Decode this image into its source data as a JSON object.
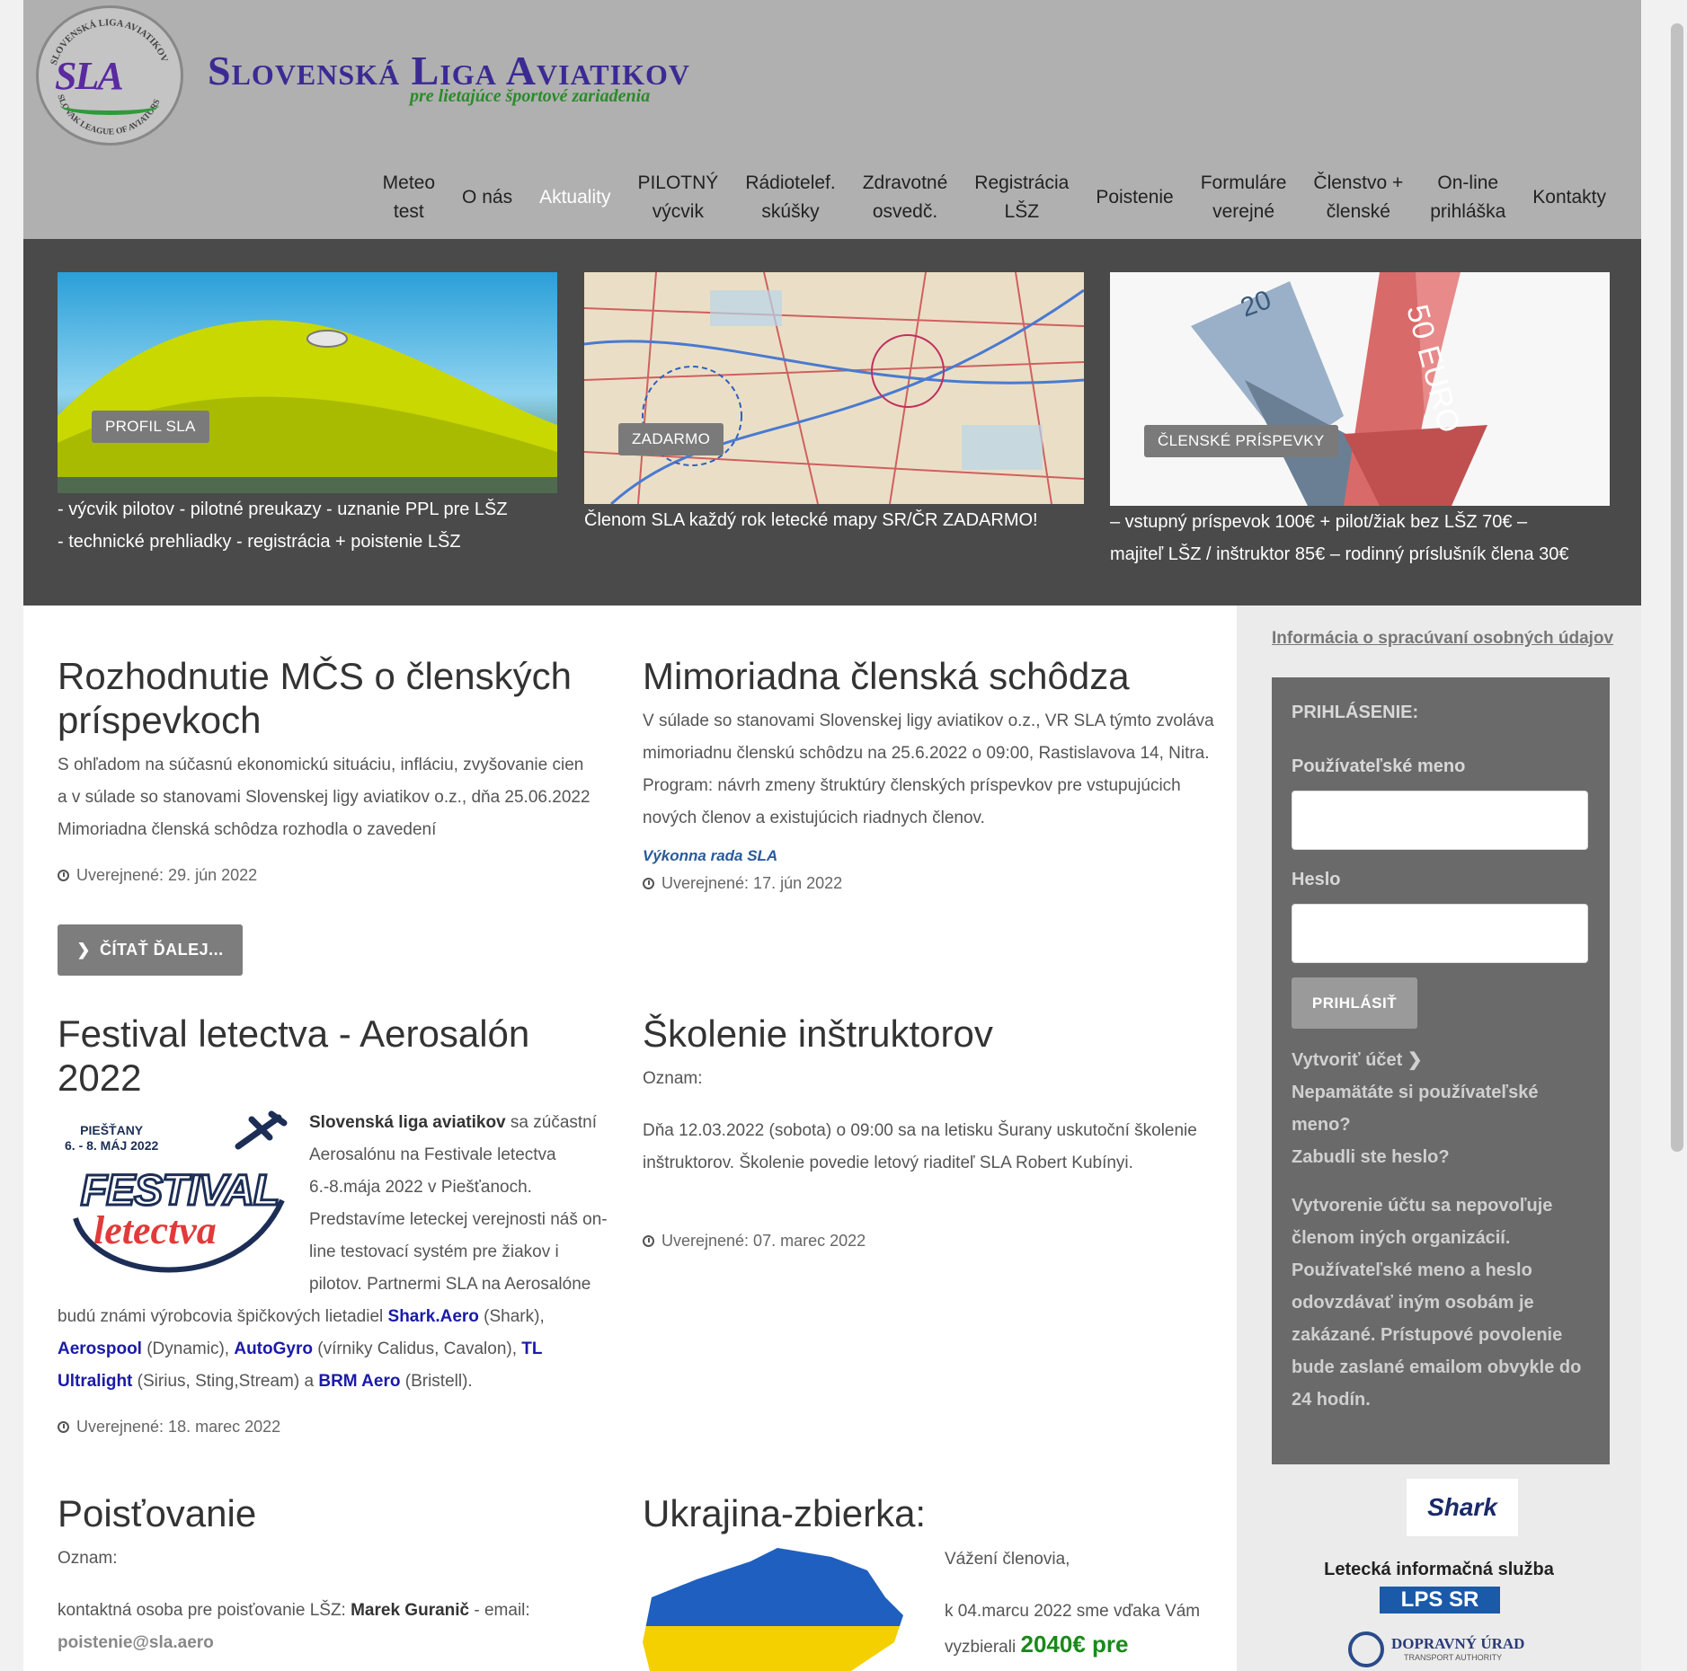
{
  "header": {
    "title": "Slovenská Liga Aviatikov",
    "subtitle": "pre lietajúce športové zariadenia",
    "logo_text": "SLA",
    "logo_ring_top": "SLOVENSKÁ LIGA AVIATIKOV",
    "logo_ring_bottom": "SLOVAK LEAGUE OF AVIATORS"
  },
  "nav": [
    {
      "l1": "Meteo",
      "l2": "test"
    },
    {
      "l1": "O nás",
      "l2": ""
    },
    {
      "l1": "Aktuality",
      "l2": ""
    },
    {
      "l1": "PILOTNÝ",
      "l2": "výcvik"
    },
    {
      "l1": "Rádiotelef.",
      "l2": "skúšky"
    },
    {
      "l1": "Zdravotné",
      "l2": "osvedč."
    },
    {
      "l1": "Registrácia",
      "l2": "LŠZ"
    },
    {
      "l1": "Poistenie",
      "l2": ""
    },
    {
      "l1": "Formuláre",
      "l2": "verejné"
    },
    {
      "l1": "Členstvo +",
      "l2": "členské"
    },
    {
      "l1": "On-line",
      "l2": "prihláška"
    },
    {
      "l1": "Kontakty",
      "l2": ""
    }
  ],
  "featured": [
    {
      "tag": "PROFIL SLA",
      "line1": "- výcvik pilotov - pilotné preukazy - uznanie PPL pre LŠZ",
      "line2": "- technické prehliadky - registrácia + poistenie LŠZ"
    },
    {
      "tag": "ZADARMO",
      "line1": "Členom SLA každý rok letecké mapy SR/ČR ZADARMO!",
      "line2": ""
    },
    {
      "tag": "ČLENSKÉ PRÍSPEVKY",
      "line1": "– vstupný príspevok 100€ + pilot/žiak bez LŠZ 70€ –",
      "line2": "majiteľ LŠZ / inštruktor 85€ – rodinný príslušník člena 30€"
    }
  ],
  "articles": {
    "a1": {
      "title": "Rozhodnutie MČS o členských príspevkoch",
      "body": "S ohľadom na súčasnú ekonomickú situáciu, infláciu, zvyšovanie cien a v súlade so stanovami Slovenskej ligy aviatikov o.z., dňa 25.06.2022 Mimoriadna členská schôdza rozhodla o zavedení",
      "date": "Uverejnené: 29. jún 2022",
      "button": "ČÍTAŤ ĎALEJ..."
    },
    "a2": {
      "title": "Mimoriadna členská schôdza",
      "body": "V súlade so stanovami Slovenskej ligy aviatikov o.z., VR SLA týmto zvoláva mimoriadnu členskú schôdzu  na 25.6.2022 o 09:00, Rastislavova 14, Nitra. Program: návrh zmeny štruktúry členských príspevkov pre vstupujúcich nových členov a existujúcich riadnych členov.",
      "signature": "Výkonna rada SLA",
      "date": "Uverejnené: 17. jún 2022"
    },
    "a3": {
      "title": "Festival letectva - Aerosalón 2022",
      "logo_place": "PIEŠŤANY",
      "logo_dates": "6. - 8. MÁJ 2022",
      "logo_word1": "FESTIVAL",
      "logo_word2": "letectva",
      "b_strong": "Slovenská liga aviatikov",
      "b1": " sa zúčastní Aerosalónu na Festivale letectva 6.-8.mája 2022 v Piešťanoch. Predstavíme leteckej verejnosti náš on-line testovací systém pre žiakov i pilotov. Partnermi SLA na Aerosalóne budú známi výrobcovia špičkových lietadiel ",
      "l1": "Shark.Aero",
      "b2": " (Shark), ",
      "l2": "Aerospool",
      "b3": " (Dynamic), ",
      "l3": "AutoGyro",
      "b4": " (vírniky Calidus, Cavalon), ",
      "l4": "TL Ultralight",
      "b5": " (Sirius, Sting,Stream) a ",
      "l5": "BRM Aero",
      "b6": " (Bristell).",
      "date": "Uverejnené: 18. marec 2022"
    },
    "a4": {
      "title": "Školenie inštruktorov",
      "p1": "Oznam:",
      "p2": "Dňa 12.03.2022 (sobota) o 09:00 sa na letisku Šurany uskutoční školenie inštruktorov. Školenie povedie letový riaditeľ SLA Robert Kubínyi.",
      "date": "Uverejnené: 07. marec 2022"
    },
    "a5": {
      "title": "Poisťovanie",
      "p1": "Oznam:",
      "p2a": "kontaktná osoba pre poisťovanie LŠZ:  ",
      "p2b": "Marek Guranič",
      "p2c": " - email:",
      "email": "poistenie@sla.aero"
    },
    "a6": {
      "title": "Ukrajina-zbierka:",
      "p1": "Vážení členovia,",
      "p2a": "k  04.marcu 2022 sme vďaka Vám vyzbierali ",
      "p2b": "2040€ pre"
    }
  },
  "sidebar": {
    "privacy_link": "Informácia o spracúvaní osobných údajov",
    "login_title": "PRIHLÁSENIE:",
    "username_label": "Používateľské meno",
    "password_label": "Heslo",
    "login_button": "PRIHLÁSIŤ",
    "create_account": "Vytvoriť účet",
    "forgot_username": "Nepamätáte si používateľské meno?",
    "forgot_password": "Zabudli ste heslo?",
    "note": "Vytvorenie účtu sa nepovoľuje členom iných organizácií. Používateľské meno a heslo odovzdávať iným osobám je zakázané. Prístupové povolenie bude zaslané emailom obvykle do 24 hodín.",
    "shark_logo": "Shark",
    "lis_title": "Letecká informačná služba",
    "lps_logo": "LPS SR",
    "du_logo": "DOPRAVNÝ ÚRAD",
    "du_sub": "TRANSPORT AUTHORITY"
  },
  "colors": {
    "header_bg": "#b0b0b0",
    "band_bg": "#4a4a4a",
    "title_blue": "#3c2a94",
    "subtitle_green": "#2c8a2c",
    "link_blue": "#1a1aa8",
    "highlight_green": "#1a8a1a"
  }
}
